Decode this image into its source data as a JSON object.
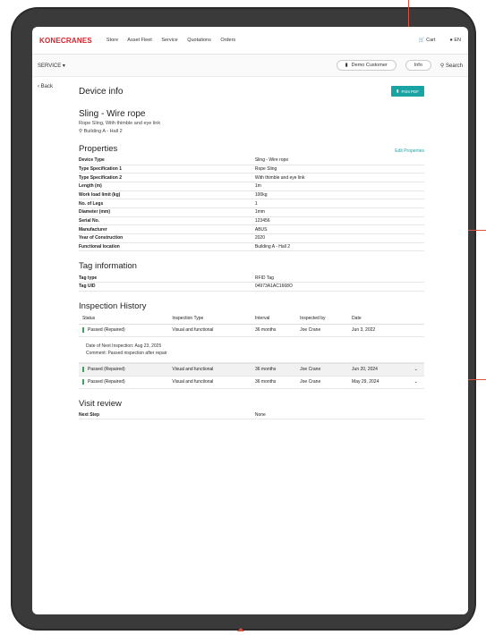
{
  "topbar": {
    "logo": "KONECRANES",
    "nav": [
      "Store",
      "Asset Fleet",
      "Service",
      "Quotations",
      "Orders"
    ],
    "cart": "Cart",
    "lang": "EN"
  },
  "subbar": {
    "section": "SERVICE",
    "customer": "Demo Customer",
    "info": "Info",
    "search": "Search"
  },
  "back_label": "Back",
  "page_title": "Device info",
  "print_pdf": "Print PDF",
  "device": {
    "name": "Sling - Wire rope",
    "description": "Rope Sling, With thimble and eye link",
    "location": "Building A - Hall 2"
  },
  "properties": {
    "title": "Properties",
    "edit_label": "Edit Properties",
    "rows": [
      {
        "label": "Device Type",
        "value": "Sling - Wire rope"
      },
      {
        "label": "Type Specification 1",
        "value": "Rope Sling"
      },
      {
        "label": "Type Specification 2",
        "value": "With thimble and eye link"
      },
      {
        "label": "Length (m)",
        "value": "1m"
      },
      {
        "label": "Work load limit (kg)",
        "value": "100kg"
      },
      {
        "label": "No. of Legs",
        "value": "1"
      },
      {
        "label": "Diameter (mm)",
        "value": "1mm"
      },
      {
        "label": "Serial No.",
        "value": "123456"
      },
      {
        "label": "Manufacturer",
        "value": "ABUS"
      },
      {
        "label": "Year of Construction",
        "value": "2020"
      },
      {
        "label": "Functional location",
        "value": "Building A - Hall 2"
      }
    ]
  },
  "tag": {
    "title": "Tag information",
    "rows": [
      {
        "label": "Tag type",
        "value": "RFID Tag"
      },
      {
        "label": "Tag UID",
        "value": "04973A1AC1668O"
      }
    ]
  },
  "inspection": {
    "title": "Inspection History",
    "headers": [
      "Status",
      "Inspection Type",
      "Interval",
      "Inspected by",
      "Date"
    ],
    "rows": [
      {
        "status": "Passed (Repaired)",
        "type": "Visual and functional",
        "interval": "36 months",
        "by": "Joe Crane",
        "date": "Jun 3, 2022"
      },
      {
        "status": "Passed (Repaired)",
        "type": "Visual and functional",
        "interval": "36 months",
        "by": "Joe Crane",
        "date": "Jun 20, 2024"
      },
      {
        "status": "Passed (Repaired)",
        "type": "Visual and functional",
        "interval": "36 months",
        "by": "Joe Crane",
        "date": "May 29, 2024"
      }
    ],
    "detail_next": "Date of Next Inspection: Aug 23, 2025",
    "detail_comment": "Comment: Passed inspection after repair"
  },
  "visit": {
    "title": "Visit review",
    "label": "Next Step",
    "value": "None"
  },
  "colors": {
    "brand": "#d7212a",
    "accent": "#1aa3a3",
    "status": "#3da35a",
    "annotation": "#d9533a"
  }
}
